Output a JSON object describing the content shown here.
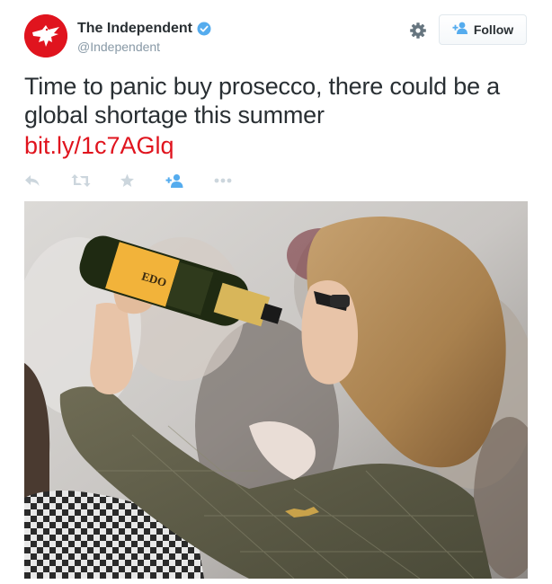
{
  "account": {
    "fullname": "The Independent",
    "screen_name": "@Independent",
    "verified": true,
    "brand_color": "#e0141e"
  },
  "header": {
    "follow_label": "Follow",
    "settings_icon": "gear-icon",
    "follow_icon": "add-user-icon"
  },
  "tweet": {
    "text": "Time to panic buy prosecco, there could be a global shortage this summer",
    "link": "bit.ly/1c7AGlq",
    "link_color": "#e0141e"
  },
  "actions": [
    {
      "name": "reply",
      "icon": "reply-icon"
    },
    {
      "name": "retweet",
      "icon": "retweet-icon"
    },
    {
      "name": "favorite",
      "icon": "star-icon"
    },
    {
      "name": "follow",
      "icon": "add-user-icon"
    },
    {
      "name": "more",
      "icon": "more-icon"
    }
  ],
  "media": {
    "label_text": "EDO"
  }
}
